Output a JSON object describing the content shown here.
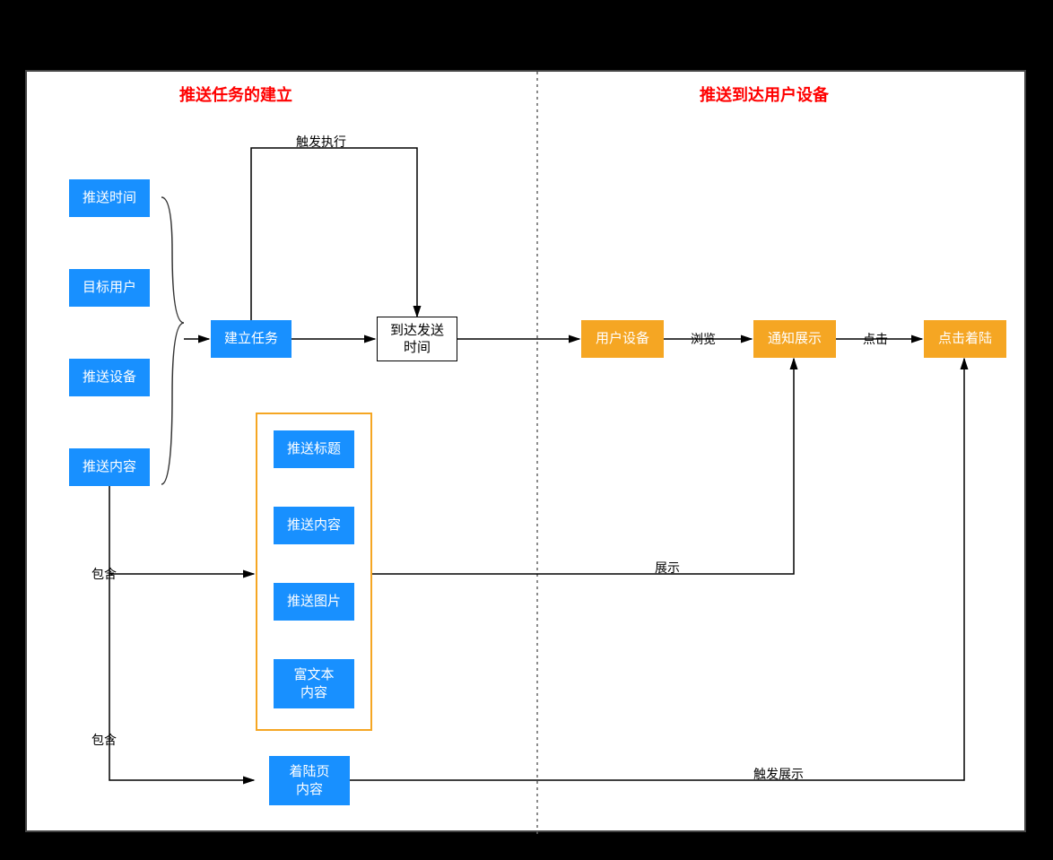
{
  "headers": {
    "left": "推送任务的建立",
    "right": "推送到达用户设备"
  },
  "leftColumn": {
    "pushTime": "推送时间",
    "targetUser": "目标用户",
    "pushDevice": "推送设备",
    "pushContent": "推送内容"
  },
  "center": {
    "createTask": "建立任务",
    "arriveSendTime": "到达发送\n时间",
    "contentGroup": {
      "pushTitle": "推送标题",
      "pushContent": "推送内容",
      "pushImage": "推送图片",
      "richText": "富文本\n内容"
    },
    "landingPage": "着陆页\n内容"
  },
  "rightFlow": {
    "userDevice": "用户设备",
    "notificationDisplay": "通知展示",
    "clickLanding": "点击着陆"
  },
  "edgeLabels": {
    "triggerExec": "触发执行",
    "contain1": "包含",
    "contain2": "包含",
    "browse": "浏览",
    "click": "点击",
    "display": "展示",
    "triggerDisplay": "触发展示"
  }
}
